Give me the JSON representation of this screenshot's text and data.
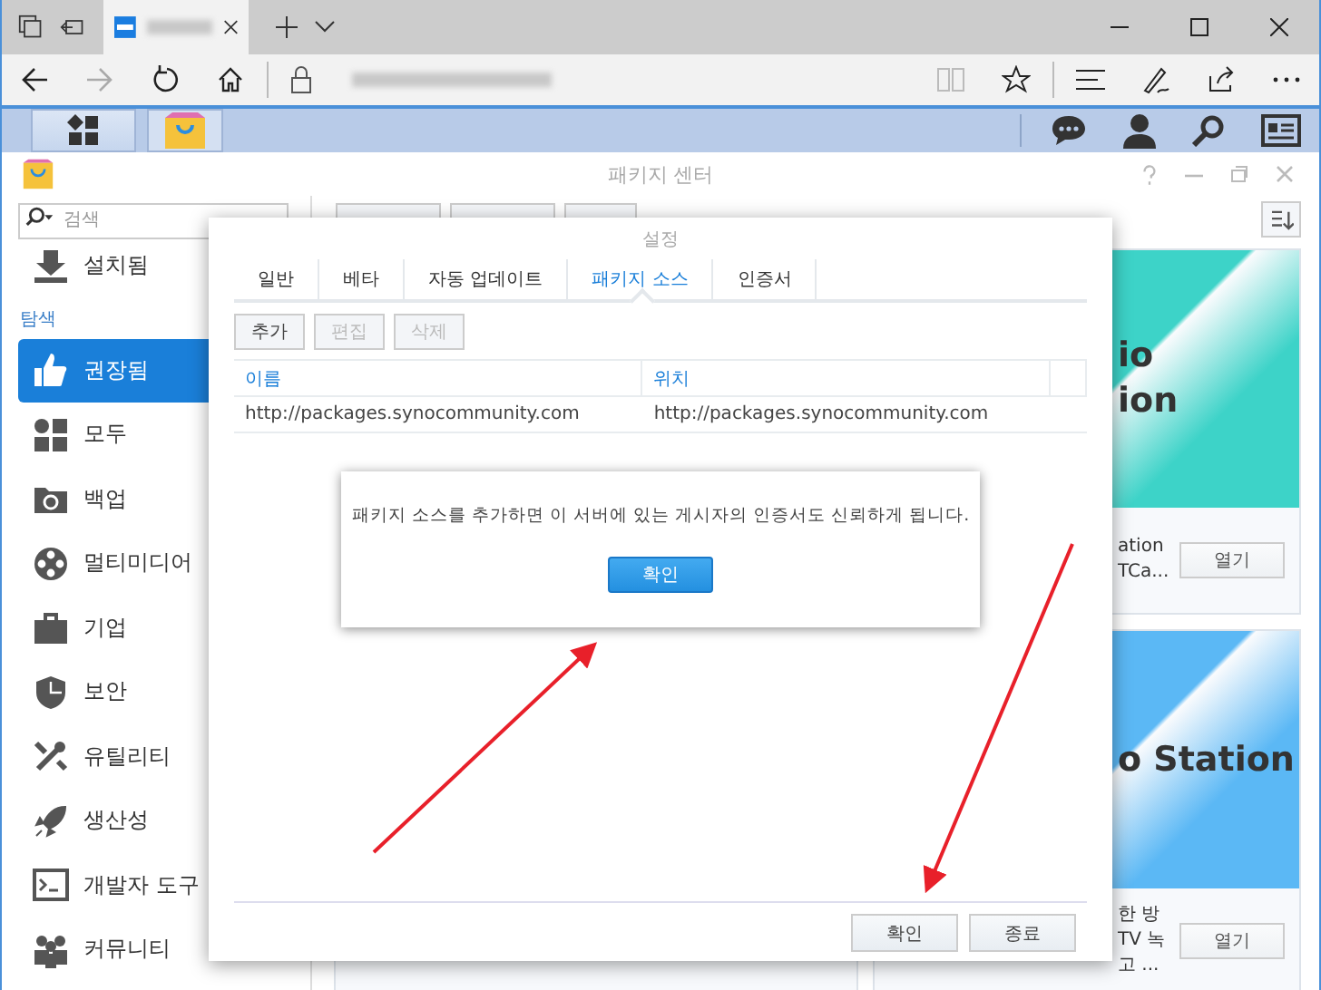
{
  "window": {
    "title": "패키지 센터"
  },
  "sidebar": {
    "search": {
      "placeholder": "검색"
    },
    "installed": {
      "label": "설치됨",
      "selected": false
    },
    "section_label": "탐색",
    "items": [
      {
        "label": "권장됨",
        "selected": true
      },
      {
        "label": "모두",
        "selected": false
      },
      {
        "label": "백업",
        "selected": false
      },
      {
        "label": "멀티미디어",
        "selected": false
      },
      {
        "label": "기업",
        "selected": false
      },
      {
        "label": "보안",
        "selected": false
      },
      {
        "label": "유틸리티",
        "selected": false
      },
      {
        "label": "생산성",
        "selected": false
      },
      {
        "label": "개발자 도구",
        "selected": false
      },
      {
        "label": "커뮤니티",
        "selected": false
      }
    ]
  },
  "cards": [
    {
      "title": [
        "io",
        "ion"
      ],
      "description": [
        "ation",
        "TCa..."
      ],
      "button": "열기",
      "color": "#3dd3c8"
    },
    {
      "title": [
        "o Station"
      ],
      "description": [
        "한 방",
        "TV 녹",
        "고 ..."
      ],
      "button": "열기",
      "color": "#5bb8f5"
    }
  ],
  "settings_dialog": {
    "title": "설정",
    "tabs": [
      {
        "label": "일반",
        "selected": false
      },
      {
        "label": "베타",
        "selected": false
      },
      {
        "label": "자동 업데이트",
        "selected": false
      },
      {
        "label": "패키지 소스",
        "selected": true
      },
      {
        "label": "인증서",
        "selected": false
      }
    ],
    "buttons": [
      {
        "label": "추가",
        "disabled": false
      },
      {
        "label": "편집",
        "disabled": true
      },
      {
        "label": "삭제",
        "disabled": true
      }
    ],
    "table": {
      "columns": [
        "이름",
        "위치"
      ],
      "rows": [
        [
          "http://packages.synocommunity.com",
          "http://packages.synocommunity.com"
        ]
      ]
    },
    "footer_buttons": [
      "확인",
      "종료"
    ]
  },
  "alert": {
    "message": "패키지 소스를 추가하면 이 서버에 있는 게시자의 인증서도 신뢰하게 됩니다.",
    "button": "확인"
  }
}
